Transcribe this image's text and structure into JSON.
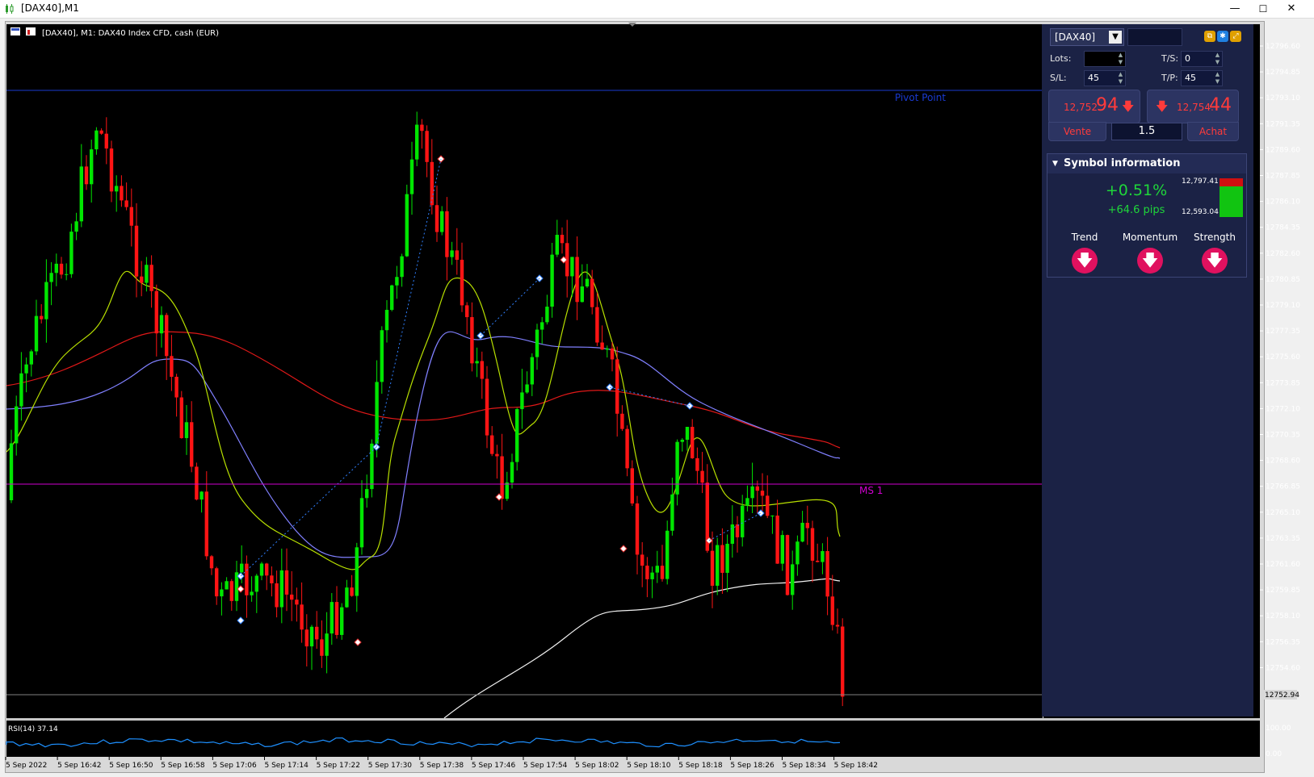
{
  "window": {
    "title": "[DAX40],M1",
    "controls": {
      "minimize": "—",
      "maximize": "☐",
      "close": "✕"
    }
  },
  "chart": {
    "header": "[DAX40], M1:  DAX40 Index CFD, cash (EUR)",
    "price_levels": [
      "12796.60",
      "12794.85",
      "12793.10",
      "12791.35",
      "12789.60",
      "12787.85",
      "12786.10",
      "12784.35",
      "12782.60",
      "12780.85",
      "12779.10",
      "12777.35",
      "12775.60",
      "12773.85",
      "12772.10",
      "12770.35",
      "12768.60",
      "12766.85",
      "12765.10",
      "12763.35",
      "12761.60",
      "12759.85",
      "12758.10",
      "12756.35",
      "12754.60"
    ],
    "current_price": "12752.94",
    "pivot_label": "Pivot Point",
    "ms1_label": "MS 1",
    "time_labels": [
      "5 Sep 2022",
      "5 Sep 16:42",
      "5 Sep 16:50",
      "5 Sep 16:58",
      "5 Sep 17:06",
      "5 Sep 17:14",
      "5 Sep 17:22",
      "5 Sep 17:30",
      "5 Sep 17:38",
      "5 Sep 17:46",
      "5 Sep 17:54",
      "5 Sep 18:02",
      "5 Sep 18:10",
      "5 Sep 18:18",
      "5 Sep 18:26",
      "5 Sep 18:34",
      "5 Sep 18:42"
    ],
    "rsi_label": "RSI(14) 37.14",
    "rsi_scale": [
      "100.00",
      "0.00"
    ],
    "colors": {
      "bull": "#00e600",
      "bear": "#ff1414",
      "pivot": "#1a3ad0",
      "ms1": "#d000d0",
      "ema_fast": "#b8e000",
      "ema_mid": "#8080ff",
      "ema_slow": "#e01818",
      "ma_long": "#f0f0f0",
      "rsi": "#1e90ff"
    }
  },
  "panel": {
    "symbol": "[DAX40]",
    "lots_label": "Lots:",
    "ts_label": "T/S:",
    "ts_value": "0",
    "sl_label": "S/L:",
    "sl_value": "45",
    "tp_label": "T/P:",
    "tp_value": "45",
    "sell": {
      "small": "12,752.",
      "big": "94",
      "label": "Vente"
    },
    "buy": {
      "small": "12,754.",
      "big": "44",
      "label": "Achat"
    },
    "spread": "1.5",
    "symbol_info": {
      "title": "Symbol information",
      "change_pct": "+0.51%",
      "change_pips": "+64.6 pips",
      "high": "12,797.41",
      "low": "12,593.04",
      "indicators": [
        {
          "label": "Trend",
          "icon": "arrow-down-icon"
        },
        {
          "label": "Momentum",
          "icon": "arrow-down-icon"
        },
        {
          "label": "Strength",
          "icon": "arrow-down-icon"
        }
      ]
    }
  }
}
